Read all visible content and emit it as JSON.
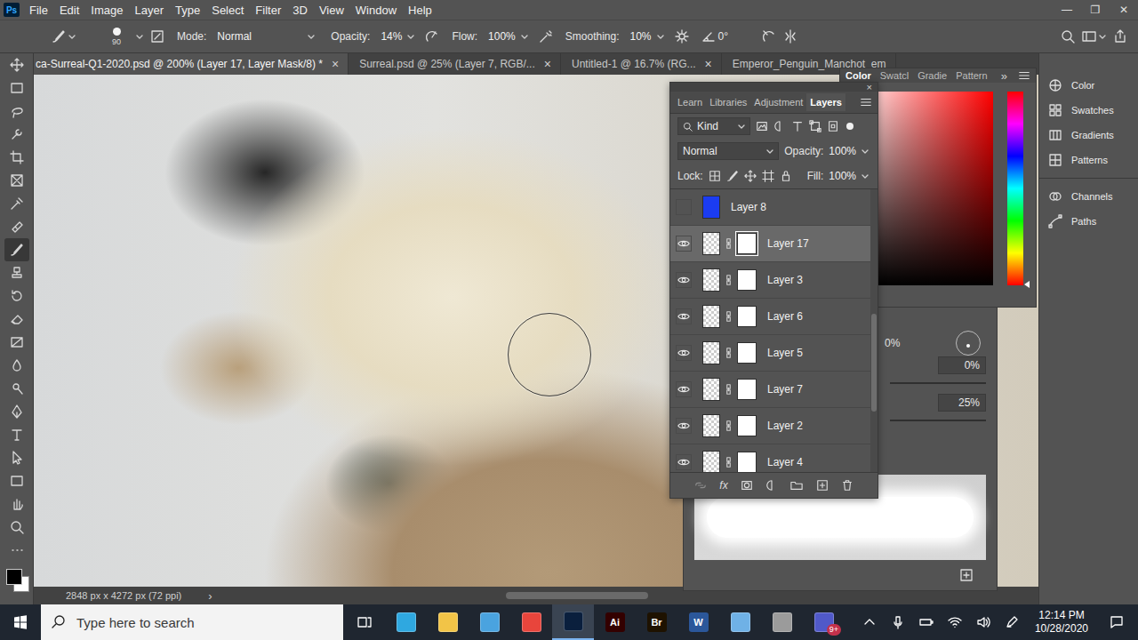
{
  "app": {
    "logo": "Ps"
  },
  "menu": [
    "File",
    "Edit",
    "Image",
    "Layer",
    "Type",
    "Select",
    "Filter",
    "3D",
    "View",
    "Window",
    "Help"
  ],
  "window_controls": [
    "—",
    "❐",
    "✕"
  ],
  "options_bar": {
    "brush_size": "90",
    "mode": {
      "label": "Mode:",
      "value": "Normal"
    },
    "opacity": {
      "label": "Opacity:",
      "value": "14%"
    },
    "flow": {
      "label": "Flow:",
      "value": "100%"
    },
    "smoothing": {
      "label": "Smoothing:",
      "value": "10%"
    },
    "angle": "0°"
  },
  "tools": [
    {
      "kind": "move",
      "selected": false
    },
    {
      "kind": "marquee",
      "selected": false
    },
    {
      "kind": "lasso",
      "selected": false
    },
    {
      "kind": "quickselect",
      "selected": false
    },
    {
      "kind": "crop",
      "selected": false
    },
    {
      "kind": "frame",
      "selected": false
    },
    {
      "kind": "eyedropper",
      "selected": false
    },
    {
      "kind": "healing",
      "selected": false
    },
    {
      "kind": "brush",
      "selected": true
    },
    {
      "kind": "stamp",
      "selected": false
    },
    {
      "kind": "history",
      "selected": false
    },
    {
      "kind": "eraser",
      "selected": false
    },
    {
      "kind": "gradient",
      "selected": false
    },
    {
      "kind": "blur",
      "selected": false
    },
    {
      "kind": "dodge",
      "selected": false
    },
    {
      "kind": "pen",
      "selected": false
    },
    {
      "kind": "type",
      "selected": false
    },
    {
      "kind": "pathselect",
      "selected": false
    },
    {
      "kind": "rectangle",
      "selected": false
    },
    {
      "kind": "hand",
      "selected": false
    },
    {
      "kind": "zoom",
      "selected": false
    },
    {
      "kind": "more",
      "selected": false
    }
  ],
  "document_tabs": [
    {
      "label": "ca-Surreal-Q1-2020.psd @ 200% (Layer 17, Layer Mask/8) *",
      "selected": true,
      "close": "×"
    },
    {
      "label": "Surreal.psd @ 25% (Layer 7, RGB/...",
      "selected": false,
      "close": "×"
    },
    {
      "label": "Untitled-1 @ 16.7% (RG...",
      "selected": false,
      "close": "×"
    },
    {
      "label": "Emperor_Penguin_Manchot_em",
      "selected": false
    }
  ],
  "status_bar": {
    "text": "2848 px x 4272 px (72 ppi)",
    "arrow": "›"
  },
  "color_panel": {
    "tabs": [
      {
        "label": "Color",
        "selected": true
      },
      {
        "label": "Swatcl",
        "selected": false
      },
      {
        "label": "Gradie",
        "selected": false
      },
      {
        "label": "Pattern",
        "selected": false
      }
    ],
    "overflow": "»",
    "hue": {
      "level": 0
    }
  },
  "properties_panel": {
    "readings": [
      "0%",
      "0%",
      "25%"
    ]
  },
  "layers_panel": {
    "close": "×",
    "tabs": [
      {
        "label": "Learn",
        "selected": false
      },
      {
        "label": "Libraries",
        "selected": false
      },
      {
        "label": "Adjustment",
        "selected": false
      },
      {
        "label": "Layers",
        "selected": true
      }
    ],
    "filter": "Kind",
    "blend_mode": "Normal",
    "opacity": {
      "label": "Opacity:",
      "value": "100%"
    },
    "lock_label": "Lock:",
    "fill": {
      "label": "Fill:",
      "value": "100%"
    },
    "footer_fx": "fx",
    "layers": [
      {
        "name": "Layer 8",
        "visible": false,
        "selected": false,
        "kind": "fill",
        "color": "#1b3cf2"
      },
      {
        "name": "Layer 17",
        "visible": true,
        "selected": true,
        "kind": "masked"
      },
      {
        "name": "Layer 3",
        "visible": true,
        "selected": false,
        "kind": "masked"
      },
      {
        "name": "Layer 6",
        "visible": true,
        "selected": false,
        "kind": "masked"
      },
      {
        "name": "Layer 5",
        "visible": true,
        "selected": false,
        "kind": "masked"
      },
      {
        "name": "Layer 7",
        "visible": true,
        "selected": false,
        "kind": "masked"
      },
      {
        "name": "Layer 2",
        "visible": true,
        "selected": false,
        "kind": "masked"
      },
      {
        "name": "Layer 4",
        "visible": true,
        "selected": false,
        "kind": "masked"
      }
    ]
  },
  "dock": [
    {
      "label": "Color",
      "kind": "color"
    },
    {
      "label": "Swatches",
      "kind": "swatches"
    },
    {
      "label": "Gradients",
      "kind": "gradients"
    },
    {
      "label": "Patterns",
      "kind": "patterns"
    },
    {
      "label": "Channels",
      "kind": "channels"
    },
    {
      "label": "Paths",
      "kind": "paths"
    }
  ],
  "taskbar": {
    "search_placeholder": "Type here to search",
    "apps": [
      {
        "kind": "taskview",
        "active": false
      },
      {
        "kind": "edge",
        "active": false
      },
      {
        "kind": "explorer",
        "active": false
      },
      {
        "kind": "mail",
        "active": false
      },
      {
        "kind": "chrome",
        "active": false
      },
      {
        "kind": "photoshop",
        "active": true
      },
      {
        "kind": "illustrator",
        "label": "Ai",
        "active": false
      },
      {
        "kind": "bridge",
        "label": "Br",
        "active": false
      },
      {
        "kind": "word",
        "label": "W",
        "active": false
      },
      {
        "kind": "generic",
        "active": false
      },
      {
        "kind": "snip",
        "active": false
      },
      {
        "kind": "teams",
        "badge": "9+",
        "active": false
      }
    ],
    "time": "12:14 PM",
    "date": "10/28/2020"
  }
}
